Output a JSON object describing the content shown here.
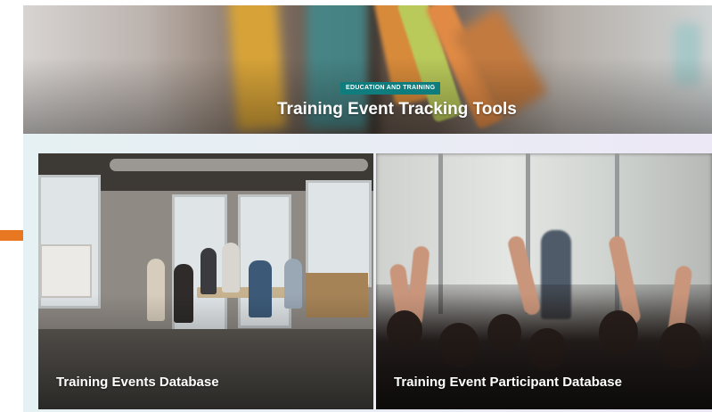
{
  "hero": {
    "tag": "EDUCATION AND TRAINING",
    "title": "Training Event Tracking Tools"
  },
  "cards": [
    {
      "label": "Training Events Database"
    },
    {
      "label": "Training Event Participant Database"
    }
  ],
  "colors": {
    "tag_background": "#0f7c7d",
    "accent": "#e87722",
    "band_start": "#e5f1f3",
    "band_end": "#ece8f5"
  }
}
